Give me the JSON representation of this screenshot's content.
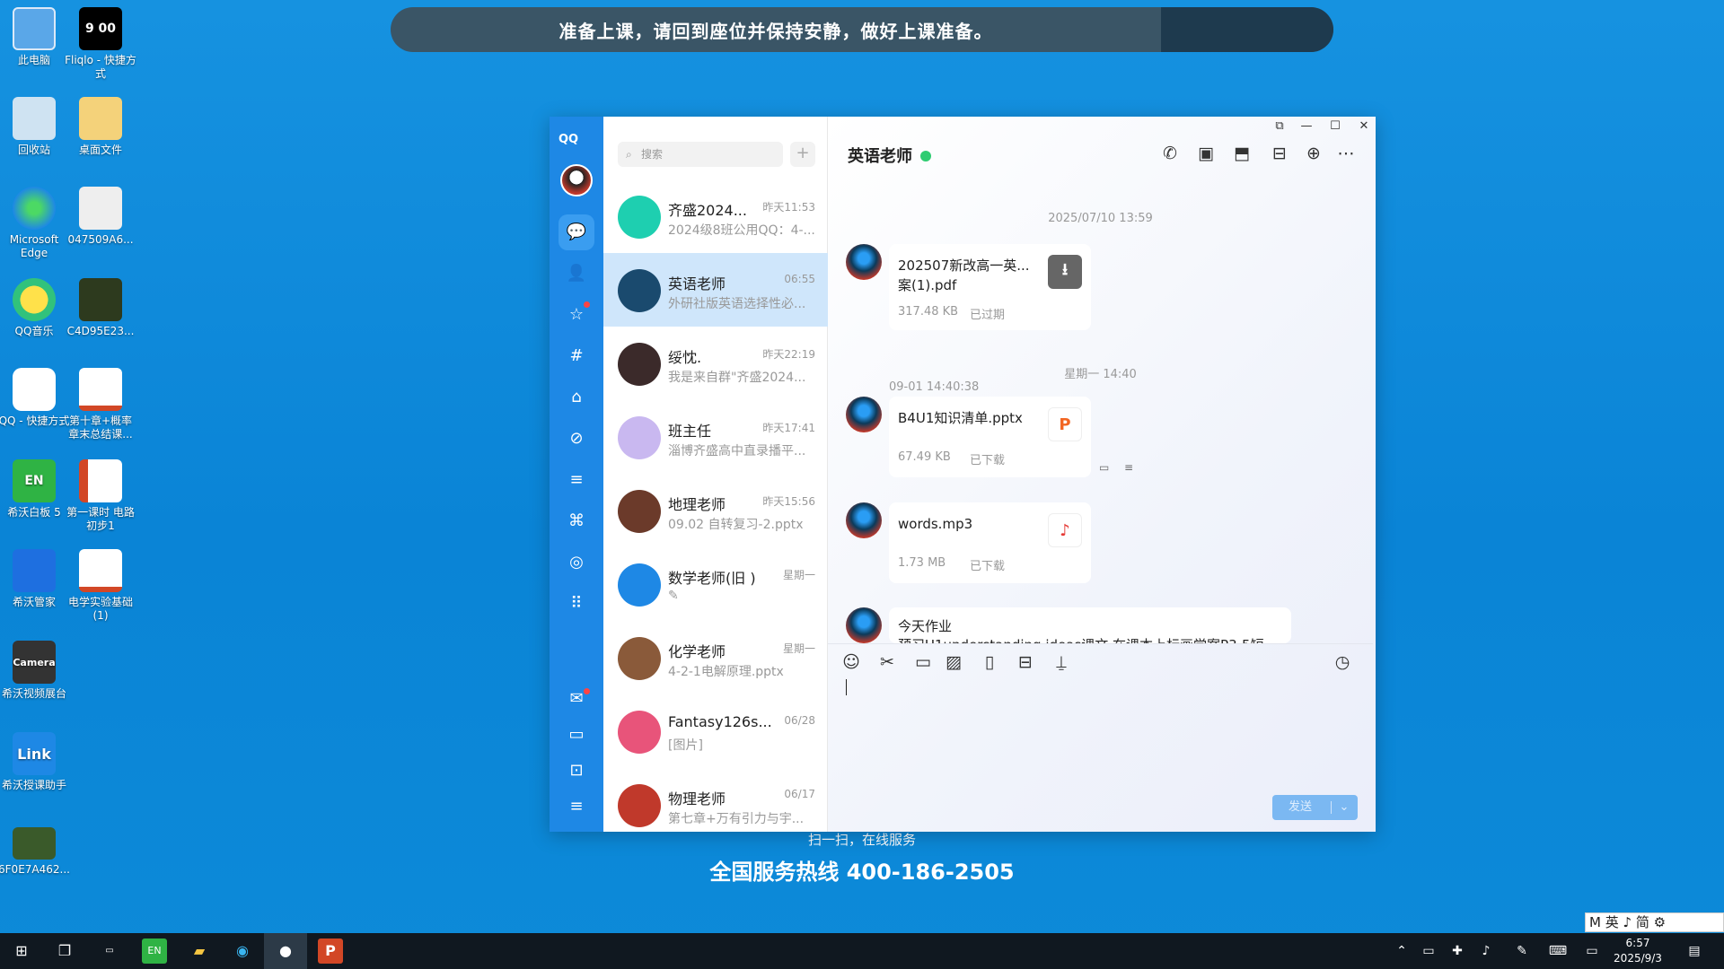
{
  "banner": {
    "text": "准备上课，请回到座位并保持安静，做好上课准备。"
  },
  "desktop": [
    {
      "label": "此电脑",
      "icon": "computer-icon"
    },
    {
      "label": "Fliqlo - 快捷方式",
      "icon": "clock-icon",
      "pic": "9 00"
    },
    {
      "label": "回收站",
      "icon": "recycle-bin-icon"
    },
    {
      "label": "桌面文件",
      "icon": "folder-icon"
    },
    {
      "label": "Microsoft Edge",
      "icon": "edge-icon"
    },
    {
      "label": "047509A6...",
      "icon": "image-file-icon"
    },
    {
      "label": "QQ音乐",
      "icon": "qq-music-icon"
    },
    {
      "label": "C4D95E23...",
      "icon": "image-file-icon"
    },
    {
      "label": "QQ - 快捷方式",
      "icon": "qq-icon"
    },
    {
      "label": "第十章+概率章末总结课...",
      "icon": "ppt-file-icon"
    },
    {
      "label": "希沃白板 5",
      "icon": "seewo-board-icon",
      "pic": "EN"
    },
    {
      "label": "第一课时 电路初步1",
      "icon": "ppt-file-icon"
    },
    {
      "label": "希沃管家",
      "icon": "seewo-manager-icon"
    },
    {
      "label": "电学实验基础(1)",
      "icon": "ppt-file-icon"
    },
    {
      "label": "希沃视频展台",
      "icon": "camera-icon",
      "pic": "Camera"
    },
    {
      "label": "希沃授课助手",
      "icon": "link-icon",
      "pic": "Link"
    },
    {
      "label": "6F0E7A462...",
      "icon": "image-file-icon"
    }
  ],
  "background": {
    "scan_text": "扫一扫，在线服务",
    "hotline": "全国服务热线 400-186-2505"
  },
  "qq": {
    "logo": "QQ",
    "search_placeholder": "搜索",
    "conversations": [
      {
        "name": "齐盛2024...",
        "time": "昨天11:53",
        "preview": "2024级8班公用QQ：4-...",
        "avatar_color": "#1ecfb0"
      },
      {
        "name": "英语老师",
        "time": "06:55",
        "preview": "外研社版英语选择性必...",
        "avatar_color": "#1a4a6e",
        "active": true
      },
      {
        "name": "绥忱.",
        "time": "昨天22:19",
        "preview": "我是来自群\"齐盛2024...",
        "avatar_color": "#3b2a2a"
      },
      {
        "name": "班主任",
        "time": "昨天17:41",
        "preview": "淄博齐盛高中直录播平...",
        "avatar_color": "#c9b8f0"
      },
      {
        "name": "地理老师",
        "time": "昨天15:56",
        "preview": "09.02 自转复习-2.pptx",
        "avatar_color": "#6b3a2a"
      },
      {
        "name": "数学老师(旧 )",
        "time": "星期一",
        "preview": "✎",
        "avatar_color": "#1e88e5"
      },
      {
        "name": "化学老师",
        "time": "星期一",
        "preview": "4-2-1电解原理.pptx",
        "avatar_color": "#8a5a3a"
      },
      {
        "name": "Fantasy126s...",
        "time": "06/28",
        "preview": "[图片]",
        "avatar_color": "#e8547a"
      },
      {
        "name": "物理老师",
        "time": "06/17",
        "preview": "第七章+万有引力与宇...",
        "avatar_color": "#c0392b"
      }
    ],
    "chat": {
      "title": "英语老师",
      "timestamp1": "2025/07/10 13:59",
      "timestamp2": "星期一 14:40",
      "sender_time": "09-01 14:40:38",
      "files": [
        {
          "name": "202507新改高一英...案(1).pdf",
          "size": "317.48 KB",
          "status": "已过期",
          "icon": "download-icon",
          "icon_bg": "#666"
        },
        {
          "name": "B4U1知识清单.pptx",
          "size": "67.49 KB",
          "status": "已下载",
          "icon": "ppt-icon",
          "glyph": "P",
          "icon_bg": "#fff",
          "icon_color": "#f26522"
        },
        {
          "name": "words.mp3",
          "size": "1.73 MB",
          "status": "已下载",
          "icon": "music-note-icon",
          "glyph": "♪",
          "icon_bg": "#fff",
          "icon_color": "#e53935"
        }
      ],
      "homework_title": "今天作业",
      "homework_text": "预习U1understanding ideas课文 在课本上标画学案P3-5短",
      "send_label": "发送"
    }
  },
  "taskbar": {
    "time": "6:57",
    "date": "2025/9/3",
    "ime": "M 英 ♪ 简 ⚙"
  }
}
